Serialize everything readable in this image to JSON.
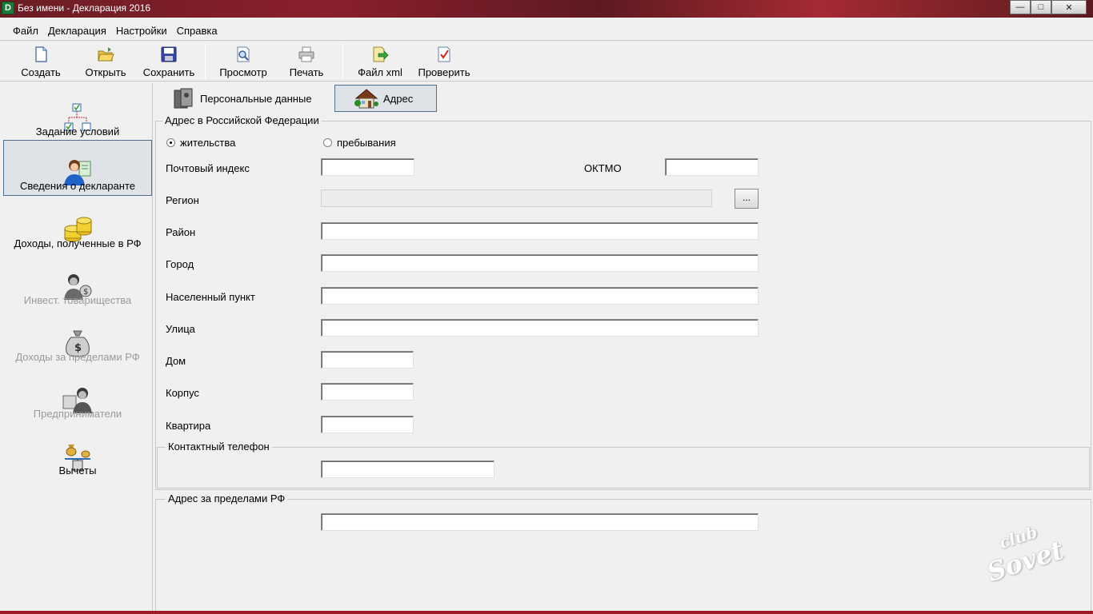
{
  "window": {
    "title": "Без имени - Декларация 2016",
    "controls": {
      "minimize": "—",
      "maximize": "□",
      "close": "✕"
    }
  },
  "menu": [
    "Файл",
    "Декларация",
    "Настройки",
    "Справка"
  ],
  "toolbar": {
    "create": "Создать",
    "open": "Открыть",
    "save": "Сохранить",
    "preview": "Просмотр",
    "print": "Печать",
    "xml": "Файл xml",
    "check": "Проверить"
  },
  "sidebar": {
    "items": [
      {
        "label": "Задание условий",
        "active": false,
        "enabled": true
      },
      {
        "label": "Сведения о декларанте",
        "active": true,
        "enabled": true
      },
      {
        "label": "Доходы, полученные в РФ",
        "active": false,
        "enabled": true
      },
      {
        "label": "Инвест. товарищества",
        "active": false,
        "enabled": false
      },
      {
        "label": "Доходы за пределами РФ",
        "active": false,
        "enabled": false
      },
      {
        "label": "Предприниматели",
        "active": false,
        "enabled": false
      },
      {
        "label": "Вычеты",
        "active": false,
        "enabled": true
      }
    ]
  },
  "tabs": {
    "personal": "Персональные данные",
    "address": "Адрес",
    "active": "address"
  },
  "address_rf": {
    "group_title": "Адрес в Российской Федерации",
    "radio_residence": "жительства",
    "radio_stay": "пребывания",
    "selected": "residence",
    "postal_code": {
      "label": "Почтовый индекс",
      "value": ""
    },
    "oktmo": {
      "label": "ОКТМО",
      "value": ""
    },
    "region": {
      "label": "Регион",
      "value": "",
      "button": "..."
    },
    "district": {
      "label": "Район",
      "value": ""
    },
    "city": {
      "label": "Город",
      "value": ""
    },
    "locality": {
      "label": "Населенный пункт",
      "value": ""
    },
    "street": {
      "label": "Улица",
      "value": ""
    },
    "house": {
      "label": "Дом",
      "value": ""
    },
    "building": {
      "label": "Корпус",
      "value": ""
    },
    "apartment": {
      "label": "Квартира",
      "value": ""
    }
  },
  "contact_phone": {
    "group_title": "Контактный телефон",
    "value": ""
  },
  "address_abroad": {
    "group_title": "Адрес за пределами РФ",
    "value": ""
  },
  "watermark": {
    "top": "club",
    "bottom": "Sovet"
  },
  "colors": {
    "titlebar": "#8a1f2e",
    "active_border": "#4f6f8f",
    "window_bg": "#f0f0f0"
  }
}
